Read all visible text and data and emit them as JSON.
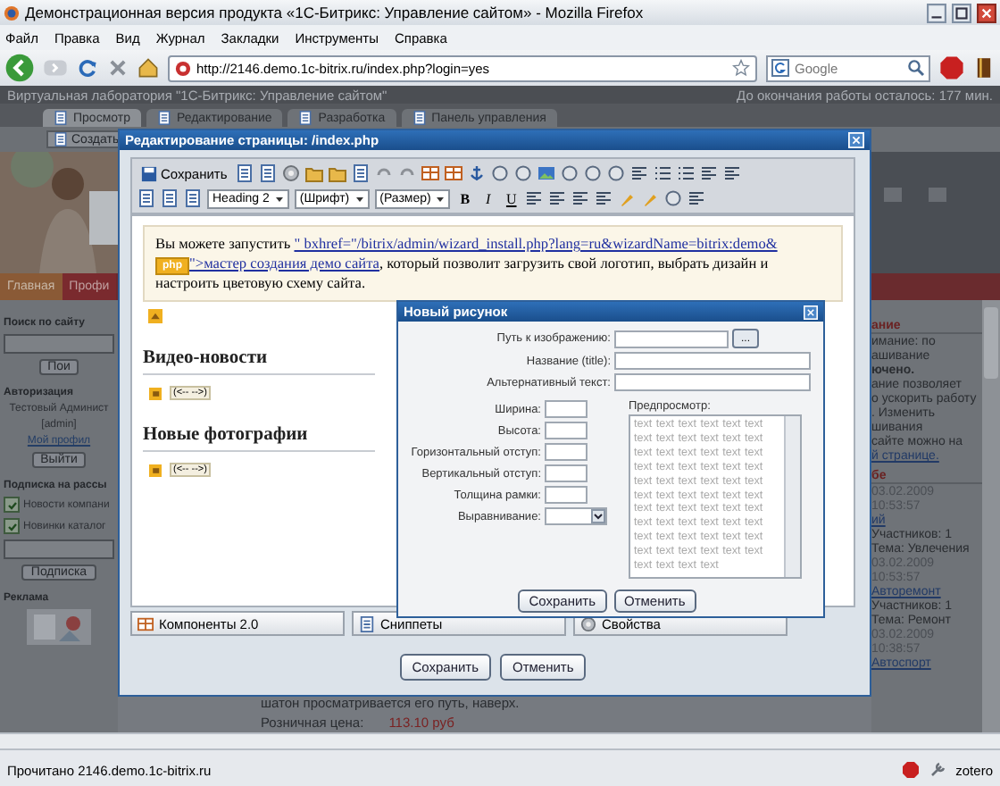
{
  "window": {
    "title": "Демонстрационная версия продукта «1С-Битрикс: Управление сайтом» - Mozilla Firefox"
  },
  "menu": [
    "Файл",
    "Правка",
    "Вид",
    "Журнал",
    "Закладки",
    "Инструменты",
    "Справка"
  ],
  "address": {
    "value": "http://2146.demo.1c-bitrix.ru/index.php?login=yes"
  },
  "search": {
    "placeholder": "Google"
  },
  "site": {
    "lab_title": "Виртуальная лаборатория \"1С-Битрикс: Управление сайтом\"",
    "time_left": "До окончания работы осталось: 177 мин.",
    "tabs": [
      {
        "label": "Просмотр",
        "selected": true
      },
      {
        "label": "Редактирование",
        "selected": false
      },
      {
        "label": "Разработка",
        "selected": false
      },
      {
        "label": "Панель управления",
        "selected": false
      }
    ],
    "create_button": "Создать",
    "nav": [
      {
        "label": "Главная",
        "selected": false
      },
      {
        "label": "Профи",
        "selected": true
      }
    ],
    "left": [
      {
        "kind": "heading",
        "text": "Поиск по сайту"
      },
      {
        "kind": "input"
      },
      {
        "kind": "button",
        "text": "Пои"
      },
      {
        "kind": "heading",
        "text": "Авторизация"
      },
      {
        "kind": "text",
        "text": "Тестовый Админист"
      },
      {
        "kind": "text",
        "text": "[admin]"
      },
      {
        "kind": "link",
        "text": "Мой профил"
      },
      {
        "kind": "button",
        "text": "Выйти"
      },
      {
        "kind": "heading",
        "text": "Подписка на рассы"
      },
      {
        "kind": "checkbox",
        "text": "Новости компани",
        "checked": true
      },
      {
        "kind": "checkbox",
        "text": "Новинки каталог",
        "checked": true
      },
      {
        "kind": "input"
      },
      {
        "kind": "button",
        "text": "Подписка"
      },
      {
        "kind": "heading",
        "text": "Реклама"
      }
    ],
    "ad_text": "шатон просматривается его путь, наверх.",
    "price_label": "Розничная цена:",
    "price": "113.10 руб",
    "right": [
      {
        "kind": "heading",
        "text": "ание"
      },
      {
        "kind": "text",
        "text": "имание: по"
      },
      {
        "kind": "text",
        "text": "ашивание"
      },
      {
        "kind": "bold",
        "text": "ючено."
      },
      {
        "kind": "text",
        "text": "ание позволяет"
      },
      {
        "kind": "text",
        "text": "о ускорить работу"
      },
      {
        "kind": "text",
        "text": ". Изменить"
      },
      {
        "kind": "text",
        "text": "шивания"
      },
      {
        "kind": "text",
        "text": "сайте можно на"
      },
      {
        "kind": "link",
        "text": "й странице."
      },
      {
        "kind": "heading",
        "text": "бе"
      },
      {
        "kind": "date",
        "text": "03.02.2009"
      },
      {
        "kind": "date",
        "text": "10:53:57"
      },
      {
        "kind": "link",
        "text": "ий"
      },
      {
        "kind": "text",
        "text": "Участников: 1"
      },
      {
        "kind": "text",
        "text": "Тема: Увлечения"
      },
      {
        "kind": "date",
        "text": "03.02.2009"
      },
      {
        "kind": "date",
        "text": "10:53:57"
      },
      {
        "kind": "link",
        "text": "Авторемонт"
      },
      {
        "kind": "text",
        "text": "Участников: 1"
      },
      {
        "kind": "text",
        "text": "Тема: Ремонт"
      },
      {
        "kind": "date",
        "text": "03.02.2009"
      },
      {
        "kind": "date",
        "text": "10:38:57"
      },
      {
        "kind": "link",
        "text": "Автоспорт"
      }
    ]
  },
  "editor": {
    "title": "Редактирование страницы: /index.php",
    "save_label": "Сохранить",
    "style_select": "Heading 2",
    "font_select": "(Шрифт)",
    "size_select": "(Размер)",
    "format_buttons": [
      "B",
      "I",
      "U"
    ],
    "notice": [
      {
        "kind": "text",
        "text": "Вы можете запустить "
      },
      {
        "kind": "link",
        "text": "\"    bxhref=\"/bitrix/admin/wizard_install.php?lang=ru&wizardName=bitrix:demo&"
      },
      {
        "kind": "badge",
        "text": "php"
      },
      {
        "kind": "link",
        "text": "\">мастер создания демо сайта"
      },
      {
        "kind": "text",
        "text": ", который позволит загрузить свой логотип, выбрать дизайн и настроить цветовую схему сайта."
      }
    ],
    "sections": [
      {
        "heading": "Видео-новости",
        "component": "(<-- -->)"
      },
      {
        "heading": "Новые фотографии",
        "component": "(<-- -->)"
      }
    ],
    "bottom_tabs": [
      {
        "label": "Компоненты 2.0",
        "selected": false
      },
      {
        "label": "Сниппеты",
        "selected": false
      },
      {
        "label": "Свойства",
        "selected": false
      }
    ],
    "buttons": [
      "Сохранить",
      "Отменить"
    ]
  },
  "image_dialog": {
    "title": "Новый рисунок",
    "browse_button": "...",
    "fields": [
      {
        "label": "Путь к изображению:",
        "kind": "browse"
      },
      {
        "label": "Название (title):",
        "kind": "text"
      },
      {
        "label": "Альтернативный текст:",
        "kind": "text"
      }
    ],
    "size_fields": [
      {
        "label": "Ширина:",
        "kind": "text"
      },
      {
        "label": "Высота:",
        "kind": "text"
      },
      {
        "label": "Горизонтальный отступ:",
        "kind": "text"
      },
      {
        "label": "Вертикальный отступ:",
        "kind": "text"
      },
      {
        "label": "Толщина рамки:",
        "kind": "text"
      },
      {
        "label": "Выравнивание:",
        "kind": "select"
      }
    ],
    "preview_label": "Предпросмотр:",
    "preview_text": "text text text text text text text text text text text text text text text text text text text text text text text text text text text text text text text text text text text text text text text text text text text text text text text text text text text text text text text text text text text text text text text text",
    "buttons": [
      "Сохранить",
      "Отменить"
    ]
  },
  "status_bar": {
    "text": "Прочитано 2146.demo.1c-bitrix.ru",
    "addon": "zotero"
  }
}
